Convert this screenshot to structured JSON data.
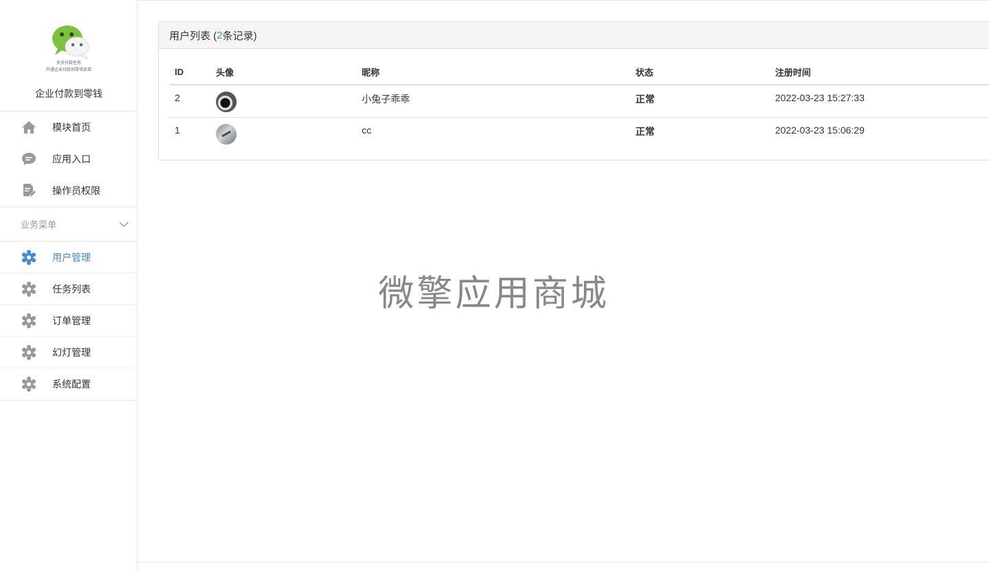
{
  "brand": {
    "tagline_1": "天天付款任务",
    "tagline_2": "开通企业付款到零钱支架",
    "name": "企业付款到零钱",
    "logo_icon": "wechat-logo-icon"
  },
  "nav": {
    "items": [
      {
        "label": "模块首页",
        "icon": "home-icon"
      },
      {
        "label": "应用入口",
        "icon": "chat-bubble-icon"
      },
      {
        "label": "操作员权限",
        "icon": "document-edit-icon"
      }
    ]
  },
  "biz_menu": {
    "title": "业务菜单",
    "items": [
      {
        "label": "用户管理",
        "icon": "gear-icon",
        "active": true
      },
      {
        "label": "任务列表",
        "icon": "gear-icon"
      },
      {
        "label": "订单管理",
        "icon": "gear-icon"
      },
      {
        "label": "幻灯管理",
        "icon": "gear-icon"
      },
      {
        "label": "系统配置",
        "icon": "gear-icon"
      }
    ]
  },
  "panel": {
    "title_prefix": "用户列表 (",
    "count": "2",
    "title_suffix": "条记录)"
  },
  "table": {
    "headers": [
      "ID",
      "头像",
      "昵称",
      "状态",
      "注册时间"
    ],
    "rows": [
      {
        "id": "2",
        "nickname": "小兔子乖乖",
        "status": "正常",
        "registered": "2022-03-23 15:27:33"
      },
      {
        "id": "1",
        "nickname": "cc",
        "status": "正常",
        "registered": "2022-03-23 15:06:29"
      }
    ]
  },
  "watermark": "微擎应用商城",
  "colors": {
    "accent": "#428bca",
    "icon_gray": "#999999",
    "brand_green": "#7cc242"
  }
}
